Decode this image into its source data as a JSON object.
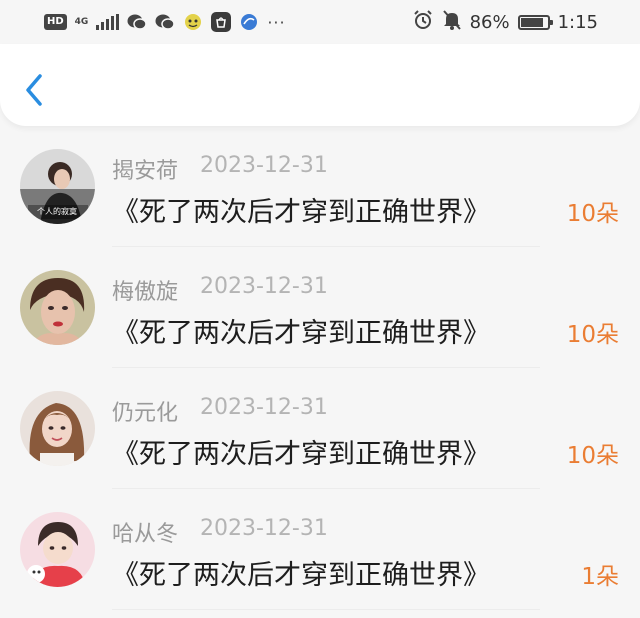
{
  "status_bar": {
    "hd": "HD",
    "network": "4G",
    "battery_percent": "86%",
    "battery_level": 0.86,
    "time": "1:15"
  },
  "colors": {
    "accent_blue": "#2a8de0",
    "amount_orange": "#ea7d33",
    "name_gray": "#9a9a9a",
    "title_dark": "#1e1e1e"
  },
  "nav": {
    "back_icon": "chevron-left-icon"
  },
  "records": [
    {
      "name": "揭安荷",
      "date": "2023-12-31",
      "title": "《死了两次后才穿到正确世界》",
      "amount": "10朵",
      "avatar_text": "个人的寂寞"
    },
    {
      "name": "梅傲旋",
      "date": "2023-12-31",
      "title": "《死了两次后才穿到正确世界》",
      "amount": "10朵"
    },
    {
      "name": "仍元化",
      "date": "2023-12-31",
      "title": "《死了两次后才穿到正确世界》",
      "amount": "10朵"
    },
    {
      "name": "哈从冬",
      "date": "2023-12-31",
      "title": "《死了两次后才穿到正确世界》",
      "amount": "1朵"
    }
  ]
}
